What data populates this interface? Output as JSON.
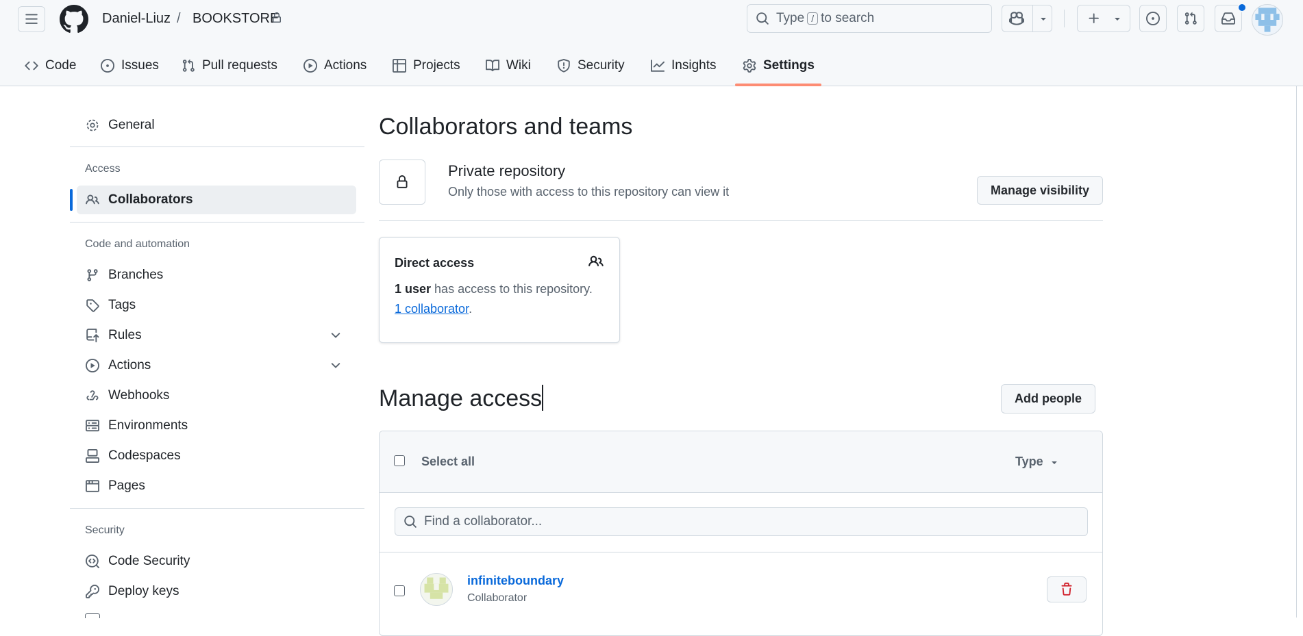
{
  "header": {
    "owner": "Daniel-Liuz",
    "separator": "/",
    "repo": "BOOKSTORE",
    "search_text_before": "Type",
    "search_key": "/",
    "search_text_after": "to search"
  },
  "tabs": [
    {
      "label": "Code",
      "icon": "code-icon"
    },
    {
      "label": "Issues",
      "icon": "issue-opened-icon"
    },
    {
      "label": "Pull requests",
      "icon": "git-pull-request-icon"
    },
    {
      "label": "Actions",
      "icon": "play-icon"
    },
    {
      "label": "Projects",
      "icon": "table-icon"
    },
    {
      "label": "Wiki",
      "icon": "book-icon"
    },
    {
      "label": "Security",
      "icon": "shield-icon"
    },
    {
      "label": "Insights",
      "icon": "graph-icon"
    },
    {
      "label": "Settings",
      "icon": "gear-icon",
      "active": true
    }
  ],
  "sidebar": {
    "general": "General",
    "access_heading": "Access",
    "collaborators": "Collaborators",
    "code_heading": "Code and automation",
    "branches": "Branches",
    "tags": "Tags",
    "rules": "Rules",
    "actions": "Actions",
    "webhooks": "Webhooks",
    "environments": "Environments",
    "codespaces": "Codespaces",
    "pages": "Pages",
    "security_heading": "Security",
    "code_security": "Code Security",
    "deploy_keys": "Deploy keys"
  },
  "main": {
    "title": "Collaborators and teams",
    "private_title": "Private repository",
    "private_desc": "Only those with access to this repository can view it",
    "manage_visibility": "Manage visibility",
    "direct_access_title": "Direct access",
    "user_count": "1 user",
    "access_text": " has access to this repository.",
    "collaborator_link": "1 collaborator",
    "period": ".",
    "manage_access_title": "Manage access",
    "add_people": "Add people",
    "select_all": "Select all",
    "type_filter": "Type",
    "find_placeholder": "Find a collaborator...",
    "collaborators": [
      {
        "name": "infiniteboundary",
        "role": "Collaborator"
      }
    ]
  },
  "colors": {
    "accent": "#0969da",
    "tab_underline": "#fd8c73",
    "danger": "#d1242f"
  }
}
